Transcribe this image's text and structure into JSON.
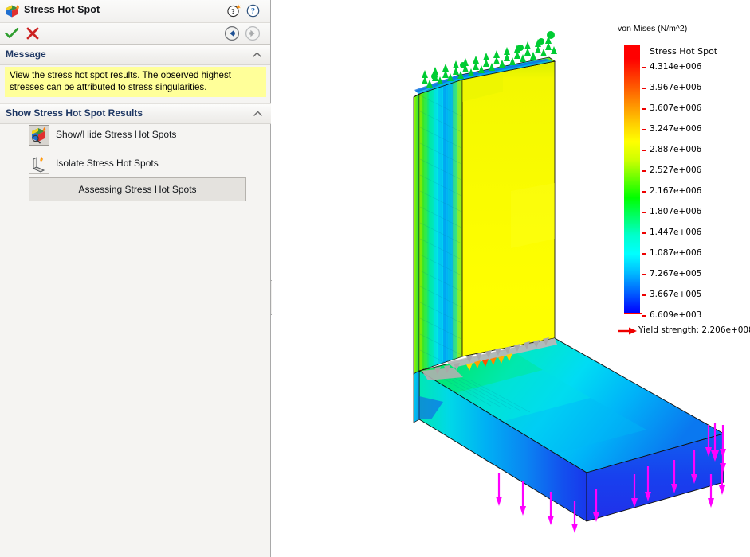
{
  "panel": {
    "title": "Stress Hot Spot",
    "title_icon": "stress-hot-spot-icon",
    "help_star_icon": "help-whats-new-icon",
    "help_icon": "help-icon",
    "ok_icon": "checkmark-ok-icon",
    "cancel_icon": "cancel-x-icon",
    "back_icon": "back-arrow-icon",
    "forward_icon": "forward-arrow-icon",
    "sections": {
      "message": {
        "header": "Message",
        "collapse_icon": "chevron-up-icon",
        "text": "View the stress hot spot results. The observed highest stresses can be attributed to stress singularities."
      },
      "results": {
        "header": "Show Stress Hot Spot Results",
        "collapse_icon": "chevron-up-icon",
        "tools": [
          {
            "label": "Show/Hide Stress Hot Spots",
            "icon": "show-hide-hot-spots-icon",
            "pressed": true
          },
          {
            "label": "Isolate Stress Hot Spots",
            "icon": "isolate-hot-spots-icon",
            "pressed": false
          }
        ],
        "assess_button": "Assessing Stress Hot Spots"
      }
    }
  },
  "legend": {
    "title": "von Mises (N/m^2)",
    "hotspot_label": "Stress Hot Spot",
    "ticks": [
      "4.314e+006",
      "3.967e+006",
      "3.607e+006",
      "3.247e+006",
      "2.887e+006",
      "2.527e+006",
      "2.167e+006",
      "1.807e+006",
      "1.447e+006",
      "1.087e+006",
      "7.267e+005",
      "3.667e+005",
      "6.609e+003"
    ],
    "yield_text": "Yield strength: 2.206e+008",
    "yield_arrow_icon": "yield-strength-arrow-icon"
  },
  "colors": {
    "legend_max": "#ff0000",
    "legend_min": "#0000ff",
    "message_bg": "#ffff99",
    "section_header_text": "#1f3864",
    "restraint_arrow": "#00cc33",
    "force_arrow": "#ff00ff",
    "hotspot_highlight": "#b0b0b0"
  },
  "model": {
    "name": "l-bracket-von-mises-plot",
    "restraint_symbol": "green-restraint-arrows",
    "load_symbol": "magenta-force-arrows"
  }
}
